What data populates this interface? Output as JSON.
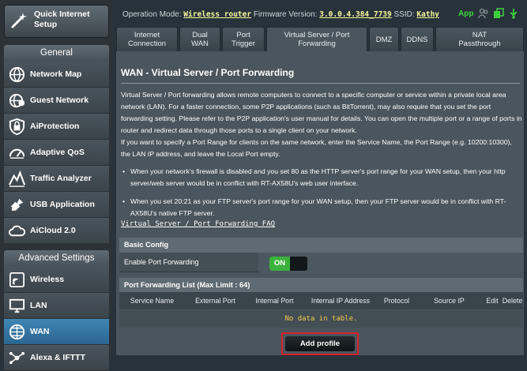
{
  "sidebar": {
    "quick_setup_line1": "Quick Internet",
    "quick_setup_line2": "Setup",
    "general_header": "General",
    "general_items": [
      {
        "label": "Network Map"
      },
      {
        "label": "Guest Network"
      },
      {
        "label": "AiProtection"
      },
      {
        "label": "Adaptive QoS"
      },
      {
        "label": "Traffic Analyzer"
      },
      {
        "label": "USB Application"
      },
      {
        "label": "AiCloud 2.0"
      }
    ],
    "advanced_header": "Advanced Settings",
    "advanced_items": [
      {
        "label": "Wireless"
      },
      {
        "label": "LAN"
      },
      {
        "label": "WAN"
      },
      {
        "label": "Alexa & IFTTT"
      }
    ]
  },
  "topbar": {
    "mode_label": "Operation Mode:",
    "mode_value": "Wireless router",
    "fw_label": "Firmware Version:",
    "fw_value": "3.0.0.4.384_7739",
    "ssid_label": "SSID:",
    "ssid_value": "Kathy",
    "app_label": "App"
  },
  "tabs": [
    {
      "line1": "Internet",
      "line2": "Connection"
    },
    {
      "line1": "Dual",
      "line2": "WAN"
    },
    {
      "line1": "Port",
      "line2": "Trigger"
    },
    {
      "line1": "Virtual Server / Port",
      "line2": "Forwarding"
    },
    {
      "line1": "DMZ",
      "line2": ""
    },
    {
      "line1": "DDNS",
      "line2": ""
    },
    {
      "line1": "NAT",
      "line2": "Passthrough"
    }
  ],
  "content": {
    "title": "WAN - Virtual Server / Port Forwarding",
    "description": "Virtual Server / Port forwarding allows remote computers to connect to a specific computer or service within a private local area network (LAN). For a faster connection, some P2P applications (such as BitTorrent), may also require that you set the port forwarding setting. Please refer to the P2P application's user manual for details. You can open the multiple port or a range of ports in router and redirect data through those ports to a single client on your network.",
    "description2": "If you want to specify a Port Range for clients on the same network, enter the Service Name, the Port Range (e.g. 10200:10300), the LAN IP address, and leave the Local Port empty.",
    "bullets": [
      "When your network's firewall is disabled and you set 80 as the HTTP server's port range for your WAN setup, then your http server/web server would be in conflict with RT-AX58U's web user interface.",
      "When you set 20:21 as your FTP server's port range for your WAN setup, then your FTP server would be in conflict with RT-AX58U's native FTP server."
    ],
    "faq_link": "Virtual Server / Port Forwarding FAQ"
  },
  "basic_config": {
    "header": "Basic Config",
    "enable_label": "Enable Port Forwarding",
    "toggle_state": "ON"
  },
  "forwarding_list": {
    "header": "Port Forwarding List (Max Limit : 64)",
    "columns": [
      "Service Name",
      "External Port",
      "Internal Port",
      "Internal IP Address",
      "Protocol",
      "Source IP",
      "Edit",
      "Delete"
    ],
    "empty_text": "No data in table."
  },
  "add_profile_label": "Add profile",
  "colors": {
    "accent_active": "#3f86b5",
    "toggle_on": "#3bb23b",
    "highlight_border": "#d91f2a",
    "link_yellow": "#f7f79b"
  }
}
